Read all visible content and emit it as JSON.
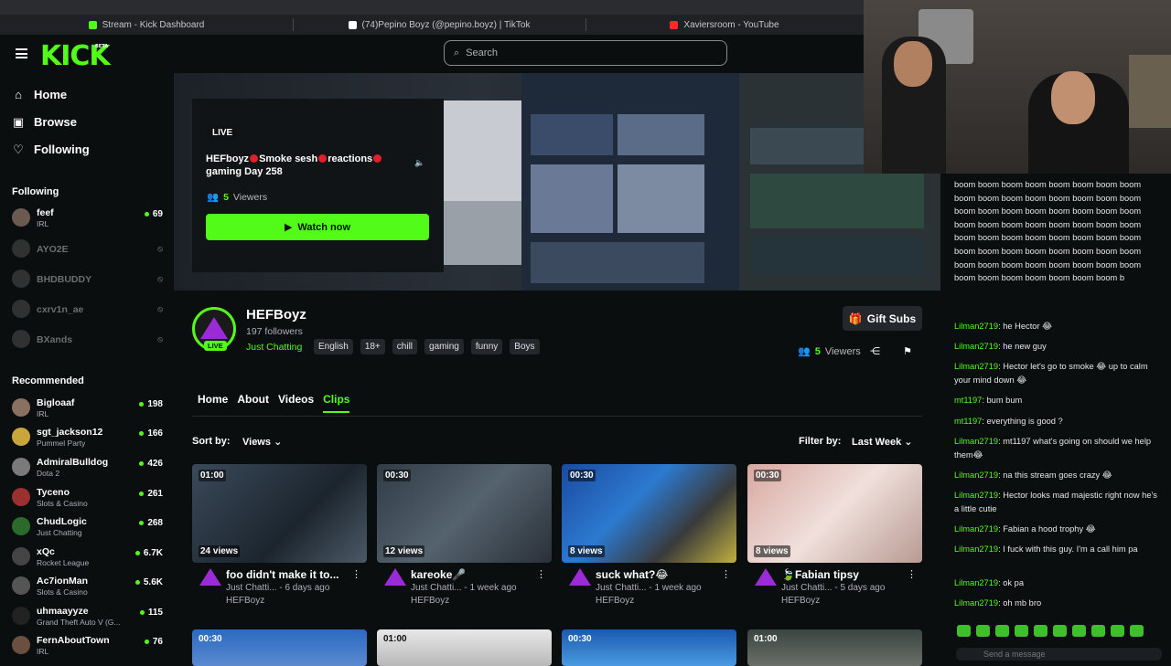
{
  "browser_tabs": [
    {
      "label": "Stream - Kick Dashboard",
      "fav_color": "#53fc18"
    },
    {
      "label": "(74)Pepino Boyz (@pepino.boyz) | TikTok",
      "fav_color": "#ffffff"
    },
    {
      "label": "Xaviersroom - YouTube",
      "fav_color": "#ff2a2a"
    }
  ],
  "brand": {
    "name": "KICK",
    "badge": "BETA",
    "accent": "#53fc18"
  },
  "nav": [
    {
      "label": "Home",
      "icon": "home-icon"
    },
    {
      "label": "Browse",
      "icon": "browse-icon"
    },
    {
      "label": "Following",
      "icon": "heart-icon"
    }
  ],
  "following": {
    "title": "Following",
    "channels": [
      {
        "name": "feef",
        "category": "IRL",
        "viewers": "69",
        "online": true
      },
      {
        "name": "AYO2E",
        "online": false
      },
      {
        "name": "BHDBUDDY",
        "online": false
      },
      {
        "name": "cxrv1n_ae",
        "online": false
      },
      {
        "name": "BXands",
        "online": false
      }
    ]
  },
  "recommended": {
    "title": "Recommended",
    "channels": [
      {
        "name": "Bigloaaf",
        "category": "IRL",
        "viewers": "198"
      },
      {
        "name": "sgt_jackson12",
        "category": "Pummel Party",
        "viewers": "166"
      },
      {
        "name": "AdmiralBulldog",
        "category": "Dota 2",
        "viewers": "426"
      },
      {
        "name": "Tyceno",
        "category": "Slots & Casino",
        "viewers": "261"
      },
      {
        "name": "ChudLogic",
        "category": "Just Chatting",
        "viewers": "268"
      },
      {
        "name": "xQc",
        "category": "Rocket League",
        "viewers": "6.7K"
      },
      {
        "name": "Ac7ionMan",
        "category": "Slots & Casino",
        "viewers": "5.6K"
      },
      {
        "name": "uhmaayyze",
        "category": "Grand Theft Auto V (G...",
        "viewers": "115"
      },
      {
        "name": "FernAboutTown",
        "category": "IRL",
        "viewers": "76"
      }
    ]
  },
  "search": {
    "placeholder": "Search"
  },
  "hero": {
    "live_label": "LIVE",
    "title_parts": [
      "HEFboyz",
      "Smoke sesh",
      "reactions",
      "gaming Day 258"
    ],
    "viewers_count": "5",
    "viewers_label": "Viewers",
    "watch_label": "Watch now"
  },
  "chat": {
    "spam": "boom boom boom boom boom boom boom boom boom boom boom boom boom boom boom boom boom boom boom boom boom boom boom boom boom boom boom boom boom boom boom boom boom boom boom boom boom boom boom boom boom boom boom boom boom boom boom boom boom boom boom boom boom boom boom boom boom boom boom boom boom boom boom b",
    "messages": [
      {
        "user": "Lilman2719",
        "text": "he Hector 😂"
      },
      {
        "user": "Lilman2719",
        "text": "he new guy"
      },
      {
        "user": "Lilman2719",
        "text": "Hector let's go to smoke 😂 up to calm your mind down 😂"
      },
      {
        "user": "mt1197",
        "text": "bum bum"
      },
      {
        "user": "mt1197",
        "text": "everything is good ?"
      },
      {
        "user": "Lilman2719",
        "text": "mt1197 what's going on should we help them😂"
      },
      {
        "user": "Lilman2719",
        "text": "na this stream goes crazy 😂"
      },
      {
        "user": "Lilman2719",
        "text": "Hector looks mad majestic right now he's a little cutie"
      },
      {
        "user": "Lilman2719",
        "text": "Fabian a hood trophy 😂"
      },
      {
        "user": "Lilman2719",
        "text": "I fuck with this guy. I'm a call him pa"
      },
      {
        "user": "Lilman2719",
        "text": "ok pa"
      },
      {
        "user": "Lilman2719",
        "text": "oh mb bro"
      }
    ],
    "send_placeholder": "Send a message"
  },
  "profile": {
    "name": "HEFBoyz",
    "followers": "197 followers",
    "live_label": "LIVE",
    "category": "Just Chatting",
    "tags": [
      "English",
      "18+",
      "chill",
      "gaming",
      "funny",
      "Boys"
    ],
    "gift_label": "Gift Subs",
    "viewers_count": "5",
    "viewers_label": "Viewers"
  },
  "tabs": [
    "Home",
    "About",
    "Videos",
    "Clips"
  ],
  "active_tab": "Clips",
  "sort": {
    "label": "Sort by:",
    "value": "Views"
  },
  "filter": {
    "label": "Filter by:",
    "value": "Last Week"
  },
  "clips": [
    {
      "duration": "01:00",
      "views": "24 views",
      "title": "foo didn't make it to...",
      "category": "Just Chatti...",
      "age": "6 days ago",
      "owner": "HEFBoyz"
    },
    {
      "duration": "00:30",
      "views": "12 views",
      "title": "kareoke🎤",
      "category": "Just Chatti...",
      "age": "1 week ago",
      "owner": "HEFBoyz"
    },
    {
      "duration": "00:30",
      "views": "8 views",
      "title": "suck what?😂",
      "category": "Just Chatti...",
      "age": "1 week ago",
      "owner": "HEFBoyz"
    },
    {
      "duration": "00:30",
      "views": "8 views",
      "title": "🍃Fabian tipsy",
      "category": "Just Chatti...",
      "age": "5 days ago",
      "owner": "HEFBoyz"
    }
  ],
  "clips_row2": [
    {
      "duration": "00:30"
    },
    {
      "duration": "01:00"
    },
    {
      "duration": "00:30"
    },
    {
      "duration": "01:00"
    }
  ]
}
